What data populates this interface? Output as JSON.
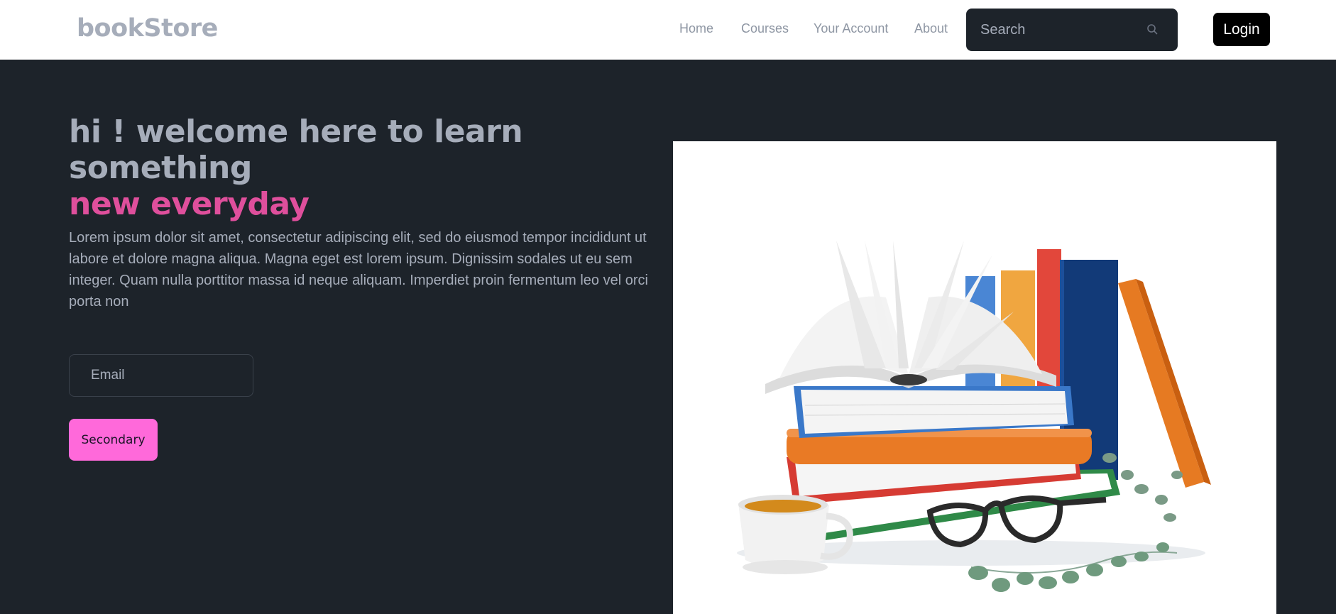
{
  "brand": "bookStore",
  "nav": {
    "items": [
      {
        "label": "Home"
      },
      {
        "label": "Courses"
      },
      {
        "label": "Your Account"
      },
      {
        "label": "About"
      }
    ],
    "search": {
      "placeholder": "Search",
      "icon": "search-icon"
    },
    "login_label": "Login"
  },
  "hero": {
    "title_part1": "hi ! welcome here to learn something",
    "title_part2": "new everyday",
    "text": "Lorem ipsum dolor sit amet, consectetur adipiscing elit, sed do eiusmod tempor incididunt ut labore et dolore magna aliqua. Magna eget est lorem ipsum. Dignissim sodales ut eu sem integer. Quam nulla porttitor massa id neque aliquam. Imperdiet proin fermentum leo vel orci porta non",
    "email_placeholder": "Email",
    "button_label": "Secondary"
  },
  "colors": {
    "navbar_bg": "#ffffff",
    "page_bg": "#1d232a",
    "text_muted": "#a6adba",
    "accent_pink": "#df4f9c",
    "button_pink": "#ff69da",
    "login_bg": "#000000"
  }
}
